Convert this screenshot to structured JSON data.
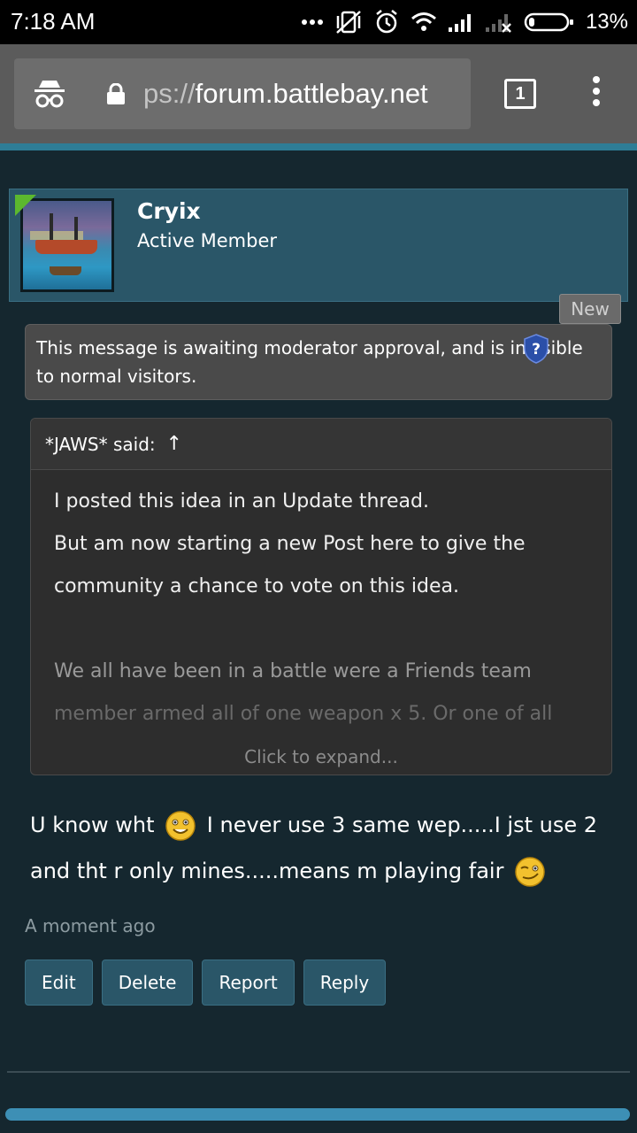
{
  "status_bar": {
    "time": "7:18 AM",
    "battery": "13%",
    "icons": [
      "more-dots-icon",
      "vibrate-off-icon",
      "alarm-icon",
      "wifi-icon",
      "signal-icon",
      "signal-x-icon",
      "battery-icon"
    ]
  },
  "browser": {
    "url_dim": "ps://",
    "url_host": "forum.battlebay.net",
    "tab_count": "1",
    "icons": [
      "incognito-icon",
      "lock-icon",
      "overflow-menu-icon"
    ],
    "accent_color": "#2e7d96"
  },
  "post": {
    "username": "Cryix",
    "user_title": "Active Member",
    "new_badge": "New",
    "moderation_notice": "This message is awaiting moderator approval, and is invisible to normal visitors.",
    "quote": {
      "author_label": "*JAWS* said:",
      "arrow": "↑",
      "lines": [
        "I posted this idea in an Update thread.",
        "But am now starting a new Post here to give the",
        "community a chance to vote on this idea.",
        "We all have been in a battle were a Friends team",
        "member armed all of one weapon x 5. Or one of all"
      ],
      "expand_label": "Click to expand..."
    },
    "message_part1": "U know wht",
    "message_part2": "I never use 3 same wep.....I jst use 2 and tht r only mines.....means m playing fair",
    "timestamp": "A moment ago",
    "actions": {
      "edit": "Edit",
      "delete": "Delete",
      "report": "Report",
      "reply": "Reply"
    }
  },
  "colors": {
    "page_bg": "#15272f",
    "header_bg": "#2a5668",
    "online_indicator": "#5cb82e",
    "bottom_bar": "#3d8fb5"
  }
}
